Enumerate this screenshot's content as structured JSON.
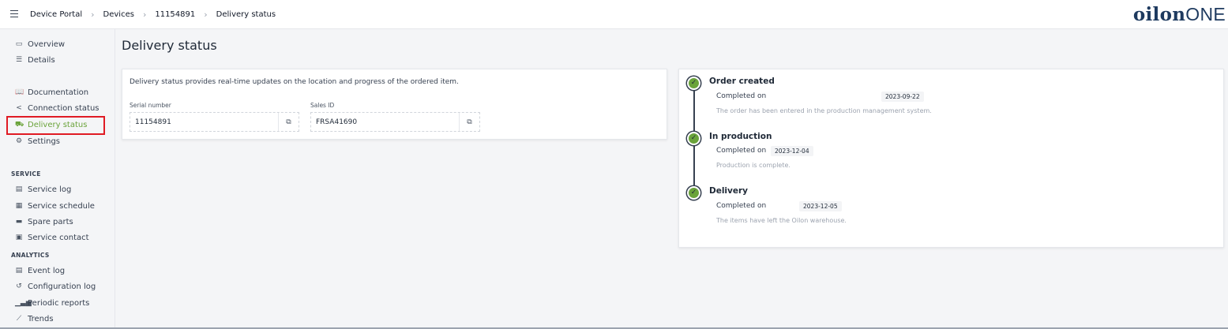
{
  "breadcrumb": [
    "Device Portal",
    "Devices",
    "11154891",
    "Delivery status"
  ],
  "logo": {
    "bold": "oilon",
    "light": "ONE"
  },
  "sidebar": {
    "group1": [
      {
        "label": "Overview",
        "icon": "window-icon"
      },
      {
        "label": "Details",
        "icon": "list-icon"
      }
    ],
    "group2": [
      {
        "label": "Documentation",
        "icon": "book-icon"
      },
      {
        "label": "Connection status",
        "icon": "share-icon"
      },
      {
        "label": "Delivery status",
        "icon": "truck-icon"
      },
      {
        "label": "Settings",
        "icon": "gear-icon"
      }
    ],
    "service_label": "SERVICE",
    "service": [
      {
        "label": "Service log",
        "icon": "log-icon"
      },
      {
        "label": "Service schedule",
        "icon": "calendar-icon"
      },
      {
        "label": "Spare parts",
        "icon": "toolbox-icon"
      },
      {
        "label": "Service contact",
        "icon": "contact-icon"
      }
    ],
    "analytics_label": "ANALYTICS",
    "analytics": [
      {
        "label": "Event log",
        "icon": "log-icon"
      },
      {
        "label": "Configuration log",
        "icon": "history-icon"
      },
      {
        "label": "Periodic reports",
        "icon": "bar-chart-icon"
      },
      {
        "label": "Trends",
        "icon": "line-chart-icon"
      }
    ]
  },
  "page_title": "Delivery status",
  "info": {
    "description": "Delivery status provides real-time updates on the location and progress of the ordered item.",
    "serial_label": "Serial number",
    "serial_value": "11154891",
    "sales_label": "Sales ID",
    "sales_value": "FRSA41690"
  },
  "timeline": [
    {
      "title": "Order created",
      "completed_label": "Completed on",
      "date": "2023-09-22",
      "description": "The order has been entered in the production management system."
    },
    {
      "title": "In production",
      "completed_label": "Completed on",
      "date": "2023-12-04",
      "description": "Production is complete."
    },
    {
      "title": "Delivery",
      "completed_label": "Completed on",
      "date": "2023-12-05",
      "description": "The items have left the Oilon warehouse."
    }
  ],
  "colors": {
    "accent": "#6aa33a",
    "highlight": "#e01b24"
  }
}
